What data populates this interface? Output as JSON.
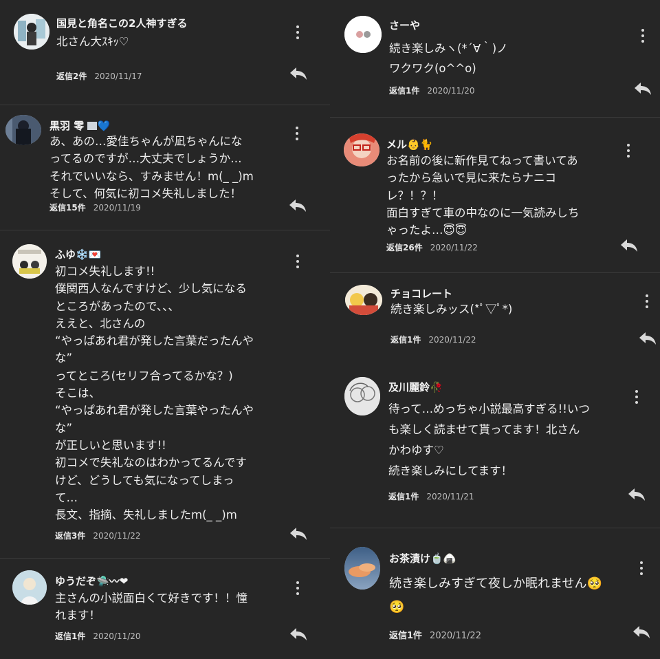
{
  "reply_icon": "reply-arrow-icon",
  "more_icon": "kebab-menu-icon",
  "left": [
    {
      "id": "c1",
      "name": "国見と角名この2人神すぎる",
      "lines": [
        "北さん大ｽｷｯ♡"
      ],
      "replies": "返信2件",
      "date": "2020/11/17"
    },
    {
      "id": "c2",
      "name": "黒羽 零",
      "name_emoji": "💙",
      "lines": [
        "あ、あの…愛佳ちゃんが凪ちゃんにな",
        "ってるのですが…大丈夫でしょうか…",
        "それでいいなら、すみません！m(_ _)m",
        "そして、何気に初コメ失礼しました！"
      ],
      "replies": "返信15件",
      "date": "2020/11/19"
    },
    {
      "id": "c3",
      "name": "ふゆ",
      "name_emoji": "❄️💌",
      "lines": [
        "初コメ失礼します!!",
        "僕関西人なんですけど、少し気になる",
        "ところがあったので、、、",
        "ええと、北さんの",
        "“やっぱあれ君が発した言葉だったんや",
        "な”",
        "ってところ(セリフ合ってるかな？)",
        "そこは、",
        "“やっぱあれ君が発した言葉やったんや",
        "な”",
        "が正しいと思います!!",
        "初コメで失礼なのはわかってるんです",
        "けど、どうしても気になってしまっ",
        "て…",
        "長文、指摘、失礼しましたm(_ _)m"
      ],
      "replies": "返信3件",
      "date": "2020/11/22"
    },
    {
      "id": "c4",
      "name": "ゆうだぞ",
      "name_emoji": "🛸〰❤",
      "lines": [
        "主さんの小説面白くて好きです！！憧",
        "れます！"
      ],
      "replies": "返信1件",
      "date": "2020/11/20"
    }
  ],
  "right": [
    {
      "id": "c5",
      "name": "さーや",
      "lines": [
        "続き楽しみヽ(*´∀｀)ノ",
        "ワクワク(o^^o)"
      ],
      "replies": "返信1件",
      "date": "2020/11/20"
    },
    {
      "id": "c6",
      "name": "メル",
      "name_emoji": "👶🐈",
      "lines": [
        "お名前の後に新作見てねって書いてあ",
        "ったから急いで見に来たらナニコ",
        "レ？！？！",
        "面白すぎて車の中なのに一気読みしち",
        "ゃったよ…😇😇"
      ],
      "replies": "返信26件",
      "date": "2020/11/22"
    },
    {
      "id": "c7",
      "name": "チョコレート",
      "lines": [
        "続き楽しみッス(*ﾟ▽ﾟ*)"
      ],
      "replies": "返信1件",
      "date": "2020/11/22"
    },
    {
      "id": "c8",
      "name": "及川麗鈴",
      "name_emoji": "🥀",
      "lines": [
        "待って…めっちゃ小説最高すぎる!!いつ",
        "も楽しく読ませて貰ってます！北さん",
        "かわゆす♡",
        "続き楽しみにしてます！"
      ],
      "replies": "返信1件",
      "date": "2020/11/21"
    },
    {
      "id": "c9",
      "name": "お茶漬け",
      "name_emoji": "🍵🍙",
      "lines": [
        "続き楽しみすぎて夜しか眠れません🥺",
        "🥺"
      ],
      "replies": "返信1件",
      "date": "2020/11/22"
    }
  ],
  "colors": {
    "background": "#262626",
    "divider": "#3a3a3a",
    "text": "#eeeeee",
    "meta": "#bdbdbd"
  }
}
